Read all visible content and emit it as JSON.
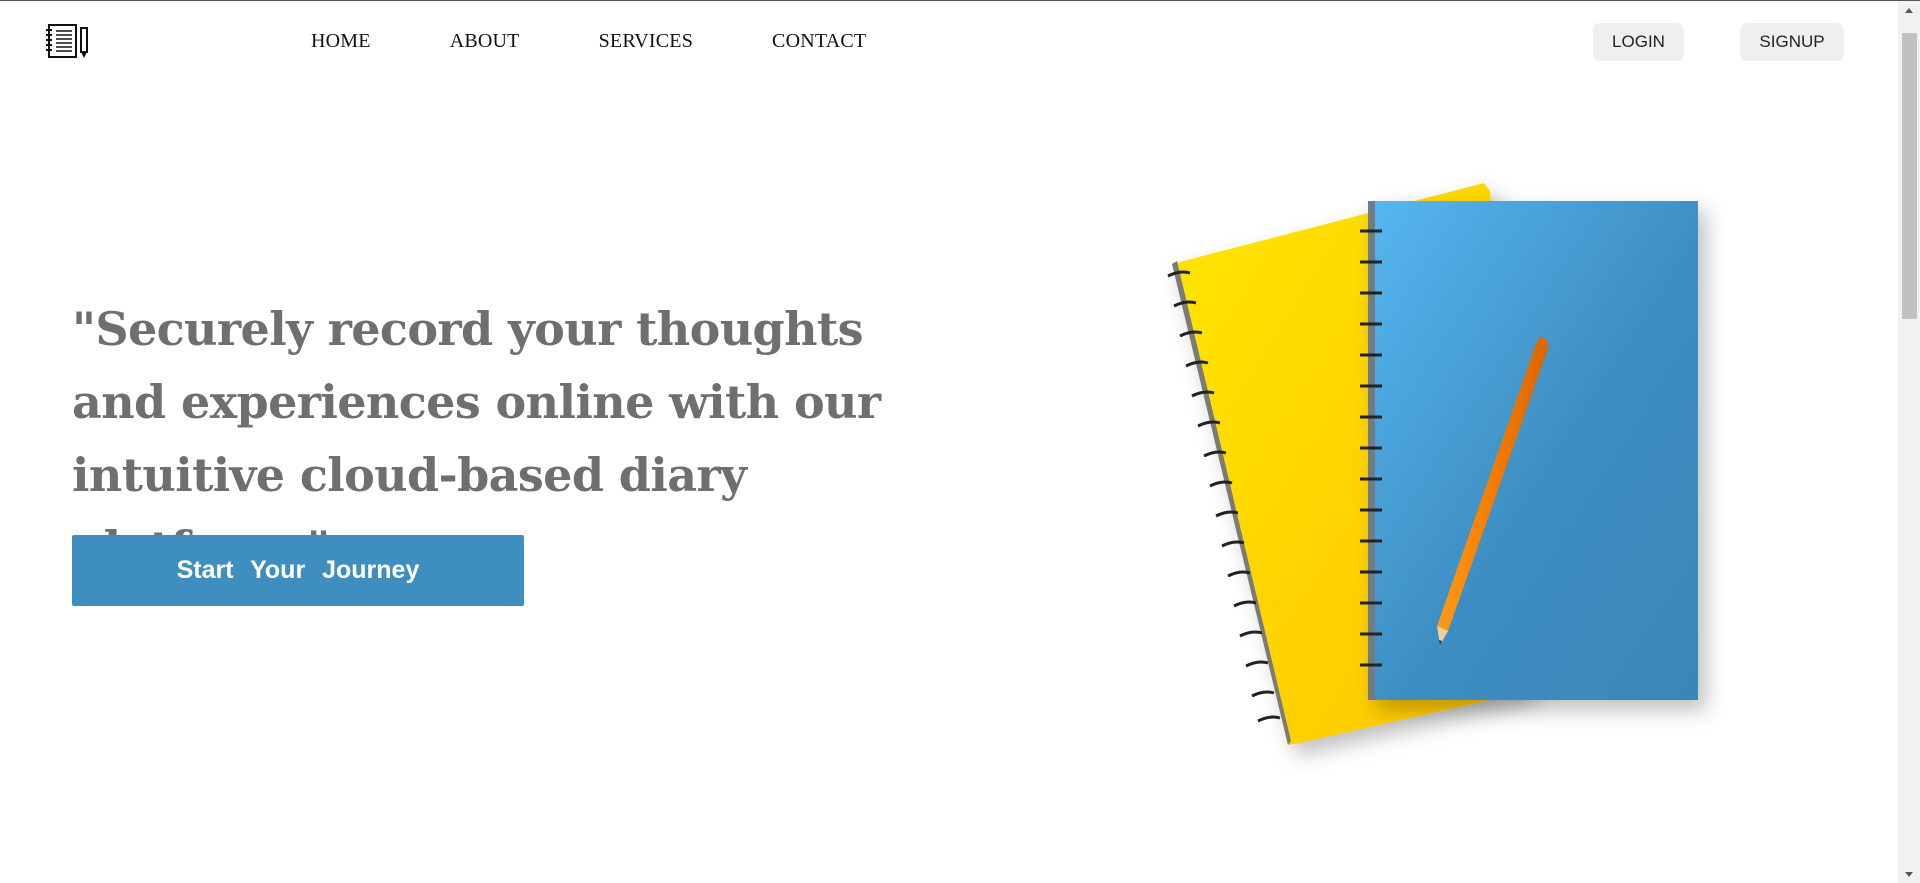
{
  "nav": {
    "logo_icon": "notebook-pencil-icon",
    "links": [
      {
        "label": "HOME"
      },
      {
        "label": "ABOUT"
      },
      {
        "label": "SERVICES"
      },
      {
        "label": "CONTACT"
      }
    ],
    "login_label": "LOGIN",
    "signup_label": "SIGNUP"
  },
  "hero": {
    "quote": "\"Securely record your thoughts and experiences online with our intuitive cloud-based diary platform.\"",
    "cta_label": "Start Your Journey",
    "illustration": "notebooks-and-pencil-illustration"
  },
  "colors": {
    "accent": "#3f8ec0",
    "quote_text": "#6f6f6f",
    "button_gray": "#efefef"
  }
}
